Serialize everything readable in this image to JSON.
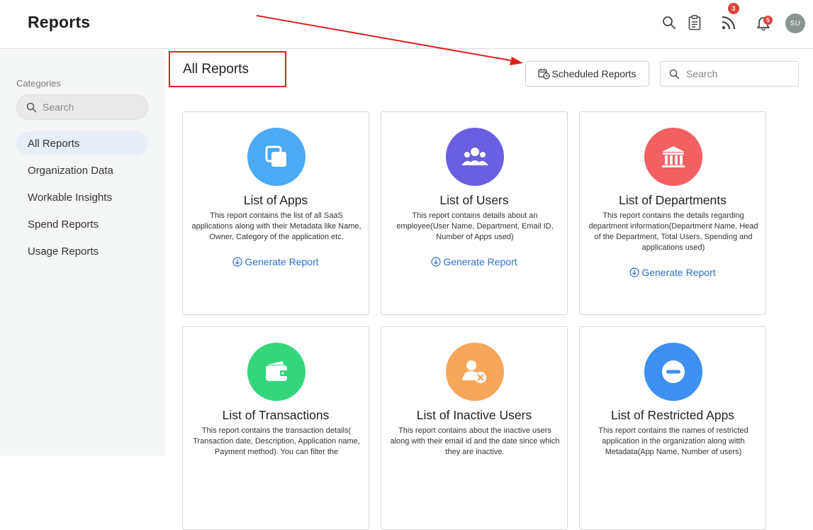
{
  "header": {
    "title": "Reports",
    "icons": [
      "search-icon",
      "clipboard-icon",
      "rss-feed-icon",
      "bell-icon"
    ],
    "feed_badge": "3",
    "bell_badge": "5",
    "avatar_initials": "SU"
  },
  "sidebar": {
    "heading": "Categories",
    "search_placeholder": "Search",
    "items": [
      {
        "label": "All Reports",
        "active": true
      },
      {
        "label": "Organization Data",
        "active": false
      },
      {
        "label": "Workable Insights",
        "active": false
      },
      {
        "label": "Spend Reports",
        "active": false
      },
      {
        "label": "Usage Reports",
        "active": false
      }
    ]
  },
  "main": {
    "title": "All Reports",
    "scheduled_label": "Scheduled Reports",
    "search_placeholder": "Search",
    "cards": [
      {
        "title": "List of Apps",
        "desc": "This report contains the list of all SaaS applications along with their Metadata like Name, Owner, Category of the application etc.",
        "link": "Generate Report",
        "color": "#4aaaf5",
        "icon": "apps-icon"
      },
      {
        "title": "List of Users",
        "desc": "This report contains details about an employee(User Name, Department, Email ID, Number of Apps used)",
        "link": "Generate Report",
        "color": "#6a5fe0",
        "icon": "users-group-icon"
      },
      {
        "title": "List of Departments",
        "desc": "This report contains the details regarding department information(Department Name, Head of the Department, Total Users, Spending and applications used)",
        "link": "Generate Report",
        "color": "#f26063",
        "icon": "building-icon"
      },
      {
        "title": "List of Transactions",
        "desc": "This report contains the transaction details( Transaction date, Description, Application name, Payment method). You can filter the",
        "link": "",
        "color": "#34d67c",
        "icon": "wallet-icon"
      },
      {
        "title": "List of Inactive Users",
        "desc": "This report contains about the inactive users along with their email id and the date since which they are inactive.",
        "link": "",
        "color": "#f7a65a",
        "icon": "user-remove-icon"
      },
      {
        "title": "List of Restricted Apps",
        "desc": "This report contains the names of restricted application in the organization along witth Metadata(App Name, Number of users)",
        "link": "",
        "color": "#3d8ff0",
        "icon": "restricted-icon"
      }
    ]
  },
  "colors": {
    "accent_link": "#2f6fc6",
    "annotation_red": "#e02020",
    "badge_red": "#d9453a"
  }
}
